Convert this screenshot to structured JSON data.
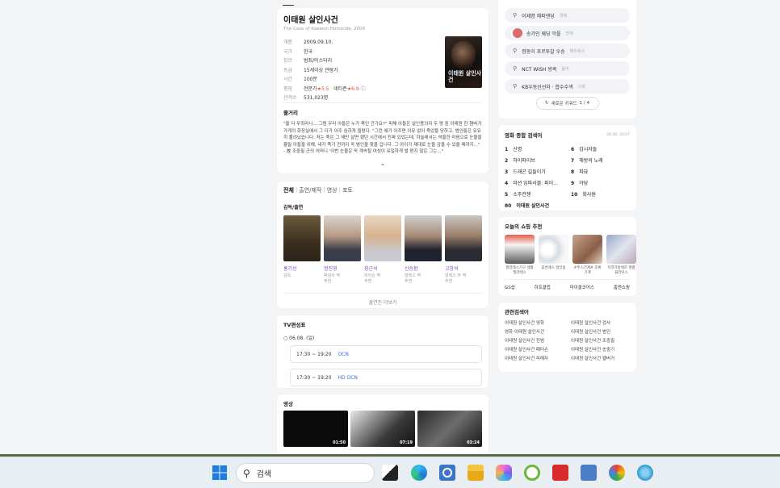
{
  "movie": {
    "title": "이태원 살인사건",
    "subtitle": "The Case of Itaewon Homicide, 2009",
    "info": [
      {
        "k": "개봉",
        "v": "2009.09.10."
      },
      {
        "k": "국가",
        "v": "한국"
      },
      {
        "k": "장르",
        "v": "범죄/미스터리"
      },
      {
        "k": "등급",
        "v": "15세이상 관람가"
      },
      {
        "k": "시간",
        "v": "100분"
      }
    ],
    "rating_label": "평점",
    "rating_expert": "전문가",
    "rating_expert_score": "5.5",
    "rating_netizen": "네티즌",
    "rating_netizen_score": "6.9",
    "audience_label": "관객수",
    "audience_value": "531,023명",
    "poster_text": "이태원 살인사건",
    "synopsis_title": "줄거리",
    "synopsis": "\"둘 다 무죄라니... 그럼 우리 아들은 누가 죽인 건가요?\" 피해 아들은 살인용의자 두 명 중 이태원 한 햄버거 가게의 화장실에서 그 다가 아주 심하게 찔렸다. \"그런 애가 아주면 이유 없이 죽었을 당하고, 범인들은 유유히 풀려났습니다. 저는 죽은 그 애만 살면 됐던 시간에서 진짜 있었는데, 하늘에서는 억울한 마음으로 눈물을 흘릴 아들을 위해, 내가 죽기 전까지 꼭 범인을 찾을 겁니다. 그 아이가 제대로 눈을 감을 수 있을 때까지...\" - 故 조중필 군의 어머니 '이번 눈물은 꼭 계속될 여성이 유일하게 벌 받지 않은 그는...\""
  },
  "tabs": {
    "all": "전체",
    "cast": "출연/제작",
    "video": "영상",
    "photo": "포토",
    "sep": "|"
  },
  "cast_section": {
    "title": "감독/출연",
    "people": [
      {
        "name": "홍기선",
        "role": "감독",
        "role2": ""
      },
      {
        "name": "정진영",
        "role": "박검사 역",
        "role2": "주연"
      },
      {
        "name": "장근석",
        "role": "피어슨 역",
        "role2": "주연"
      },
      {
        "name": "신승환",
        "role": "알렉스 역",
        "role2": "주연"
      },
      {
        "name": "고창석",
        "role": "알렉스 부 역",
        "role2": "주연"
      }
    ],
    "more": "출연진 더보기"
  },
  "tv": {
    "title": "TV편성표",
    "date": "06.08. (일)",
    "items": [
      {
        "time": "17:30 ~ 19:20",
        "channel": "OCN"
      },
      {
        "time": "17:30 ~ 19:20",
        "channel": "HD OCN"
      }
    ]
  },
  "video": {
    "title": "영상",
    "durations": [
      "01:50",
      "07:19",
      "03:24"
    ]
  },
  "keywords": {
    "items": [
      {
        "text": "이재명 해피엔딩",
        "tag": "경제"
      },
      {
        "text": "송가인 웨딩 악플",
        "tag": "연예"
      },
      {
        "text": "정동이 포르투갈 우승",
        "tag": "해외축구"
      },
      {
        "text": "NCT WISH 방콕",
        "tag": "음악"
      },
      {
        "text": "KB우동신선차 · 합수수색",
        "tag": "사회"
      }
    ],
    "refresh": "새로운 키워드",
    "page": "1 / 4"
  },
  "rank": {
    "title": "영화 종합 검색어",
    "date": "06.08. 20:07",
    "items": [
      {
        "n": "1",
        "t": "신명"
      },
      {
        "n": "6",
        "t": "감시자들"
      },
      {
        "n": "2",
        "t": "하이파이브"
      },
      {
        "n": "7",
        "t": "해방의 노래"
      },
      {
        "n": "3",
        "t": "드래곤 길들이기"
      },
      {
        "n": "8",
        "t": "파묘"
      },
      {
        "n": "4",
        "t": "미션 임파서블: 파이..."
      },
      {
        "n": "9",
        "t": "야당"
      },
      {
        "n": "5",
        "t": "소주전쟁"
      },
      {
        "n": "10",
        "t": "회사원"
      },
      {
        "n": "80",
        "t": "이태원 살인사건"
      }
    ]
  },
  "shop": {
    "title": "오늘의 쇼핑 추천",
    "items": [
      {
        "cap": "필라테스기구 생활 필라테스"
      },
      {
        "cap": "휴먼에스 일인용"
      },
      {
        "cap": "#주스기계# 초록기계"
      },
      {
        "cap": "지코가방에르 명품블라우스"
      },
      {
        "cap": ""
      }
    ],
    "tabs": [
      "GS샵",
      "하프클럽",
      "마이클코어스",
      "홈앤쇼핑"
    ]
  },
  "related": {
    "title": "관련검색어",
    "items": [
      "이태원 살인사건 영화",
      "이태원 살인사건 검사",
      "영화 이태원 살인사건",
      "이태원 살인사건 범인",
      "이태원 살인사건 진범",
      "이태원 살인사건 조중필",
      "이태원 살인사건 패터슨",
      "이태원 살인사건 송중기",
      "이태원 살인사건 피해자",
      "이태원 살인사건 웹버거"
    ]
  },
  "taskbar": {
    "search_placeholder": "검색"
  },
  "colors": {
    "accent_purple": "#7c4cc3",
    "link_blue": "#2f6fd4",
    "star_red": "#e5513f"
  }
}
